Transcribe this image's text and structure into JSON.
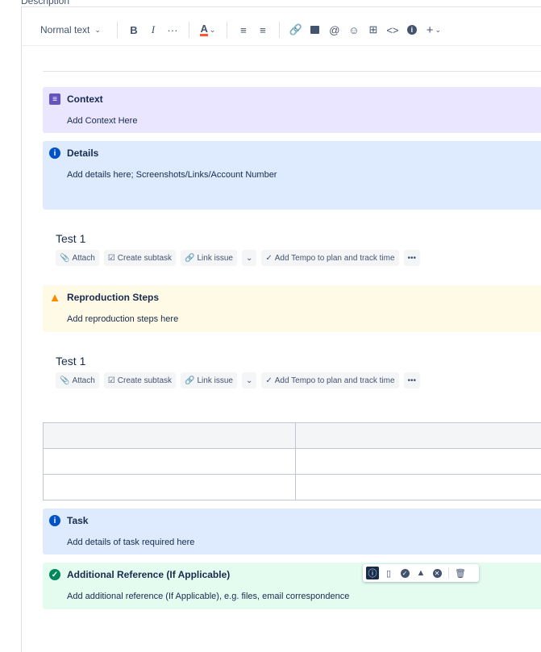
{
  "field_label": "Description",
  "toolbar": {
    "text_style": "Normal text",
    "items": [
      "bold",
      "italic",
      "more-formatting",
      "text-color",
      "bullet-list",
      "numbered-list",
      "link",
      "image",
      "mention",
      "emoji",
      "table",
      "code",
      "info",
      "insert"
    ]
  },
  "panels": {
    "context": {
      "title": "Context",
      "body": "Add Context Here",
      "color": "#eae6ff",
      "icon_color": "#6554c0"
    },
    "details": {
      "title": "Details",
      "body": "Add details here; Screenshots/Links/Account Number",
      "color": "#deebff",
      "icon_color": "#0052cc"
    },
    "repro": {
      "title": "Reproduction Steps",
      "body": "Add reproduction steps here",
      "color": "#fffae6",
      "icon_color": "#ff8b00"
    },
    "task": {
      "title": "Task",
      "body": "Add details of task required here",
      "color": "#deebff",
      "icon_color": "#0052cc"
    },
    "additional": {
      "title": "Additional Reference (If Applicable)",
      "body": "Add additional reference (If Applicable), e.g. files, email correspondence",
      "color": "#e3fcef",
      "icon_color": "#00875a"
    }
  },
  "issue1": {
    "title": "Test 1",
    "attach": "Attach",
    "subtask": "Create subtask",
    "link": "Link issue",
    "tempo": "Add Tempo to plan and track time"
  },
  "issue2": {
    "title": "Test 1",
    "attach": "Attach",
    "subtask": "Create subtask",
    "link": "Link issue",
    "tempo": "Add Tempo to plan and track time"
  },
  "panel_toolbar": [
    "info",
    "note",
    "success",
    "warning",
    "error",
    "delete"
  ]
}
